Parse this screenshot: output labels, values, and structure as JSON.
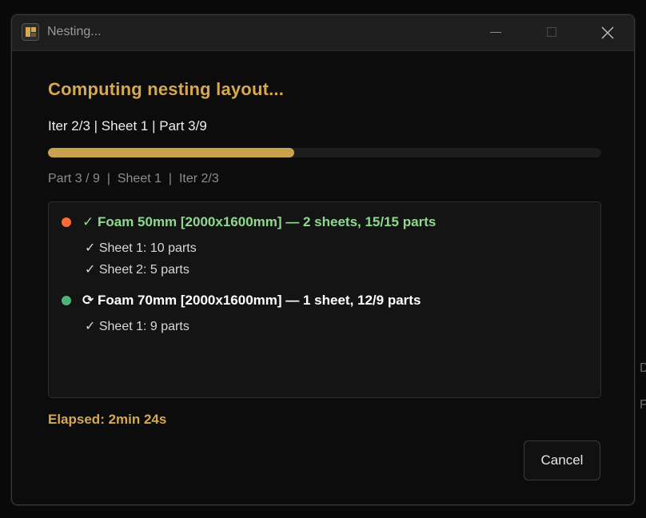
{
  "window": {
    "title": "Nesting..."
  },
  "dialog": {
    "heading": "Computing nesting layout...",
    "status_line": "Iter 2/3 | Sheet 1 | Part 3/9",
    "progress_fraction": 0.445,
    "sub_status": "Part 3 / 9  |  Sheet 1  |  Iter 2/3",
    "elapsed": "Elapsed: 2min 24s",
    "cancel_label": "Cancel"
  },
  "materials": [
    {
      "dot_color": "#ff6b35",
      "title_color": "#8fd98f",
      "status_icon": "check-icon",
      "title": "✓ Foam 50mm [2000x1600mm] — 2 sheets, 15/15 parts",
      "sheets": [
        "✓ Sheet 1: 10 parts",
        "✓ Sheet 2: 5 parts"
      ]
    },
    {
      "dot_color": "#4cb57a",
      "title_color": "#ffffff",
      "status_icon": "refresh-icon",
      "title": "⟳ Foam 70mm [2000x1600mm] — 1 sheet, 12/9 parts",
      "sheets": [
        "✓ Sheet 1: 9 parts"
      ]
    }
  ],
  "background": {
    "stray_text_1": "D",
    "stray_text_2": "F"
  }
}
